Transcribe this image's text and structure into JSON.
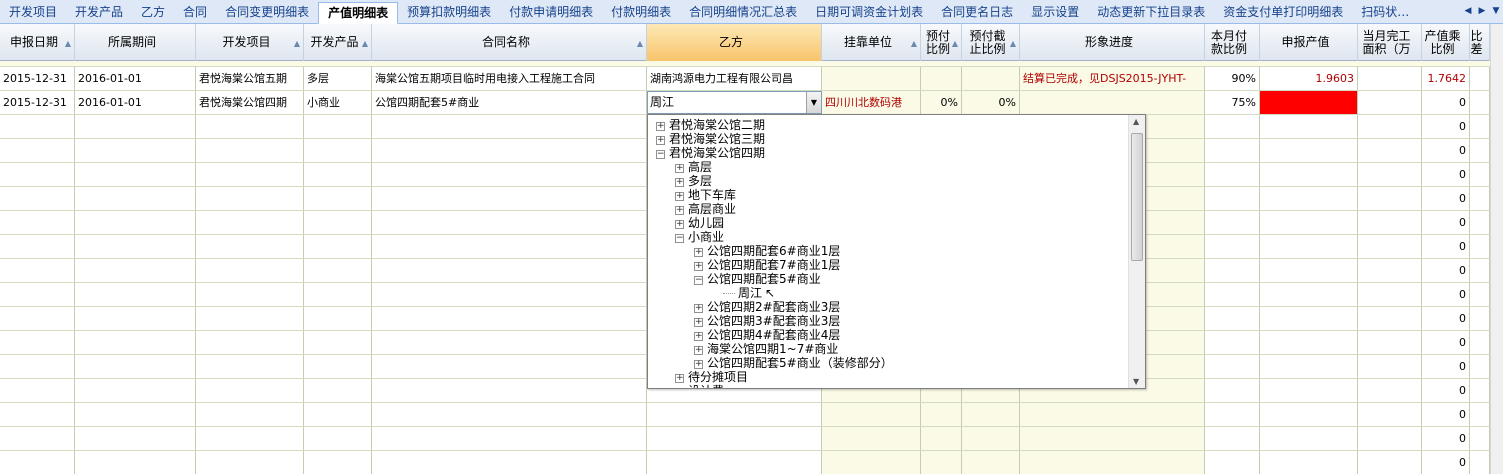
{
  "tabs": [
    "开发项目",
    "开发产品",
    "乙方",
    "合同",
    "合同变更明细表",
    "产值明细表",
    "预算扣款明细表",
    "付款申请明细表",
    "付款明细表",
    "合同明细情况汇总表",
    "日期可调资金计划表",
    "合同更名日志",
    "显示设置",
    "动态更新下拉目录表",
    "资金支付单打印明细表",
    "扫码状…"
  ],
  "active_tab": "产值明细表",
  "tab_nav": {
    "prev": "◀",
    "next": "▶",
    "close": "▼"
  },
  "columns": [
    "申报日期",
    "所属期间",
    "开发项目",
    "开发产品",
    "合同名称",
    "乙方",
    "挂靠单位",
    "预付比例",
    "预付截止比例",
    "形象进度",
    "本月付款比例",
    "申报产值",
    "当月完工面积（万",
    "产值乘比例",
    "比差"
  ],
  "rows": [
    {
      "date": "2015-12-31",
      "period": "2016-01-01",
      "project": "君悦海棠公馆五期",
      "product": "多层",
      "contract": "海棠公馆五期项目临时用电接入工程施工合同",
      "party_b": "湖南鸿源电力工程有限公司昌",
      "affiliated": "",
      "prepay": "",
      "prepay_cut": "",
      "progress": "结算已完成，见DSJS2015-JYHT-",
      "pay_ratio": "90%",
      "output": "1.9603",
      "area": "",
      "output_ratio": "1.7642"
    },
    {
      "date": "2015-12-31",
      "period": "2016-01-01",
      "project": "君悦海棠公馆四期",
      "product": "小商业",
      "contract": "公馆四期配套5#商业",
      "party_b": "周江",
      "affiliated": "四川川北数码港",
      "prepay": "0%",
      "prepay_cut": "0%",
      "progress": "",
      "pay_ratio": "75%",
      "output": "",
      "area": "",
      "output_ratio": "0"
    }
  ],
  "empty_row_value": "0",
  "combo": {
    "value": "周江",
    "dropdown_icon": "▼"
  },
  "tree": [
    {
      "label": "君悦海棠公馆二期",
      "level": 0,
      "state": "collapsed"
    },
    {
      "label": "君悦海棠公馆三期",
      "level": 0,
      "state": "collapsed"
    },
    {
      "label": "君悦海棠公馆四期",
      "level": 0,
      "state": "expanded"
    },
    {
      "label": "高层",
      "level": 1,
      "state": "collapsed"
    },
    {
      "label": "多层",
      "level": 1,
      "state": "collapsed"
    },
    {
      "label": "地下车库",
      "level": 1,
      "state": "collapsed"
    },
    {
      "label": "高层商业",
      "level": 1,
      "state": "collapsed"
    },
    {
      "label": "幼儿园",
      "level": 1,
      "state": "collapsed"
    },
    {
      "label": "小商业",
      "level": 1,
      "state": "expanded"
    },
    {
      "label": "公馆四期配套6#商业1层",
      "level": 2,
      "state": "collapsed"
    },
    {
      "label": "公馆四期配套7#商业1层",
      "level": 2,
      "state": "collapsed"
    },
    {
      "label": "公馆四期配套5#商业",
      "level": 2,
      "state": "expanded"
    },
    {
      "label": "周江",
      "level": 3,
      "state": "leaf"
    },
    {
      "label": "公馆四期2#配套商业3层",
      "level": 2,
      "state": "collapsed"
    },
    {
      "label": "公馆四期3#配套商业3层",
      "level": 2,
      "state": "collapsed"
    },
    {
      "label": "公馆四期4#配套商业4层",
      "level": 2,
      "state": "collapsed"
    },
    {
      "label": "海棠公馆四期1~7#商业",
      "level": 2,
      "state": "collapsed"
    },
    {
      "label": "公馆四期配套5#商业（装修部分）",
      "level": 2,
      "state": "collapsed"
    },
    {
      "label": "待分摊项目",
      "level": 1,
      "state": "collapsed"
    },
    {
      "label": "设计费",
      "level": 1,
      "state": "collapsed"
    }
  ],
  "icons": {
    "sort": "lock-sort-icon",
    "expand": "plus-icon",
    "collapse": "minus-icon"
  },
  "colors": {
    "selected_header": "#f8c46a",
    "row_bg": "#fafae6",
    "red_fill": "#ff0000",
    "red_text": "#b00000"
  }
}
